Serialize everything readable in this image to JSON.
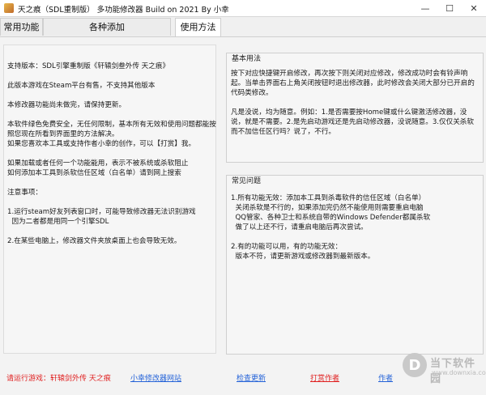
{
  "window": {
    "title": "天之痕（SDL重制版） 多功能修改器  Build on 2021 By 小幸",
    "minimize_glyph": "—",
    "maximize_glyph": "☐",
    "close_glyph": "✕"
  },
  "tabs": [
    {
      "label": "常用功能"
    },
    {
      "label": "各种添加"
    },
    {
      "label": "使用方法"
    }
  ],
  "left_panel": {
    "lines": [
      "支持版本：SDL引擎重制版《轩辕剑叁外传 天之痕》",
      "此版本游戏在Steam平台有售，不支持其他版本",
      "本修改器功能尚未做完，请保持更新。",
      "本软件绿色免费安全，无任何限制，基本所有无效和使用问题都能按照您现在所看到界面里的方法解决。\n如果您喜欢本工具或支持作者小幸的创作，可以【打赏】我。",
      "如果加载或者任何一个功能能用，表示不被系统或杀软阻止\n如何添加本工具到杀软信任区域（白名单）请到网上搜索",
      "注意事项：",
      "1.运行steam好友列表窗口时，可能导致修改器无法识别游戏\n  因为二者都是用同一个引擎SDL",
      "2.在某些电脑上，修改器文件夹放桌面上也会导致无效。"
    ]
  },
  "basic_usage": {
    "title": "基本用法",
    "p1": "按下对应快捷键开启修改，再次按下则关闭对应修改，修改成功时会有铃声响起。当单击界面右上角关闭按钮时退出修改器，此时修改会关闭大部分已开启的代码类修改。",
    "p2": "凡是没说，均为随意。例如：1.是否需要按Home键或什么键激活修改器，没说，就是不需要。2.是先启动游戏还是先启动修改器，没说随意。3.仅仅关杀软而不加信任区行吗？说了，不行。"
  },
  "faq": {
    "title": "常见问题",
    "p1": "1.所有功能无效：添加本工具到杀毒软件的信任区域（白名单）\n  关闭杀软是不行的，如果添加完仍然不能使用则需要重启电脑\n  QQ管家、各种卫士和系统自带的Windows Defender都属杀软\n  做了以上还不行，请重启电脑后再次尝试。",
    "p2": "2.有的功能可以用，有的功能无效：\n  版本不符，请更新游戏或修改器到最新版本。"
  },
  "footer": {
    "running_game": "请运行游戏：轩辕剑外传 天之痕",
    "site_link": "小幸修改器网站",
    "check_update": "检查更新",
    "donate": "打赏作者",
    "author_partial": "作者"
  },
  "watermark": {
    "logo_char": "D",
    "name": "当下软件园",
    "url": "www.downxia.com"
  },
  "colors": {
    "accent_red": "#e02020",
    "link_blue": "#2563d8"
  }
}
